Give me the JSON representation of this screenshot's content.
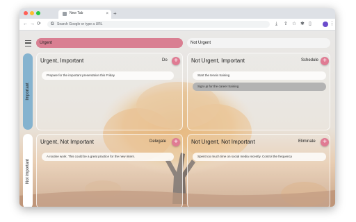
{
  "browser": {
    "tab_title": "New Tab",
    "tab_close": "×",
    "new_tab": "+",
    "omnibox_placeholder": "Search Google or type a URL",
    "colors": {
      "frame": "#dee1e6",
      "dot_red": "#ff5f57",
      "dot_yellow": "#febc2e",
      "dot_green": "#28c840"
    }
  },
  "icons": {
    "back": "←",
    "forward": "→",
    "reload": "⟳",
    "google": "G",
    "download": "⤓",
    "share": "⇪",
    "star": "☆",
    "extensions": "✱",
    "sidepanel": "▯",
    "more": "⋮",
    "add": "+"
  },
  "matrix": {
    "columns": {
      "urgent": "Urgent",
      "not_urgent": "Not Urgent"
    },
    "rows": {
      "important": "Important",
      "not_important": "Not important"
    },
    "quadrants": [
      {
        "title": "Urgent, Important",
        "action": "Do",
        "tasks": [
          {
            "text": "Prepare for the important presentation this Friday",
            "done": false
          }
        ]
      },
      {
        "title": "Not Urgent, Important",
        "action": "Schedule",
        "tasks": [
          {
            "text": "Start the tennis training",
            "done": false
          },
          {
            "text": "Sign up for the career training",
            "done": true
          }
        ]
      },
      {
        "title": "Urgent, Not Important",
        "action": "Delegate",
        "tasks": [
          {
            "text": "A routine work. This could be a great practice for the new intern.",
            "done": false
          }
        ]
      },
      {
        "title": "Not Urgent, Not Important",
        "action": "Eliminate",
        "tasks": [
          {
            "text": "Spent too much time on social media recently. Control the frequency",
            "done": false
          }
        ]
      }
    ],
    "colors": {
      "urgent_header": "#d97f92",
      "important_side": "#85b3cf",
      "add_button": "#e07b93"
    }
  }
}
